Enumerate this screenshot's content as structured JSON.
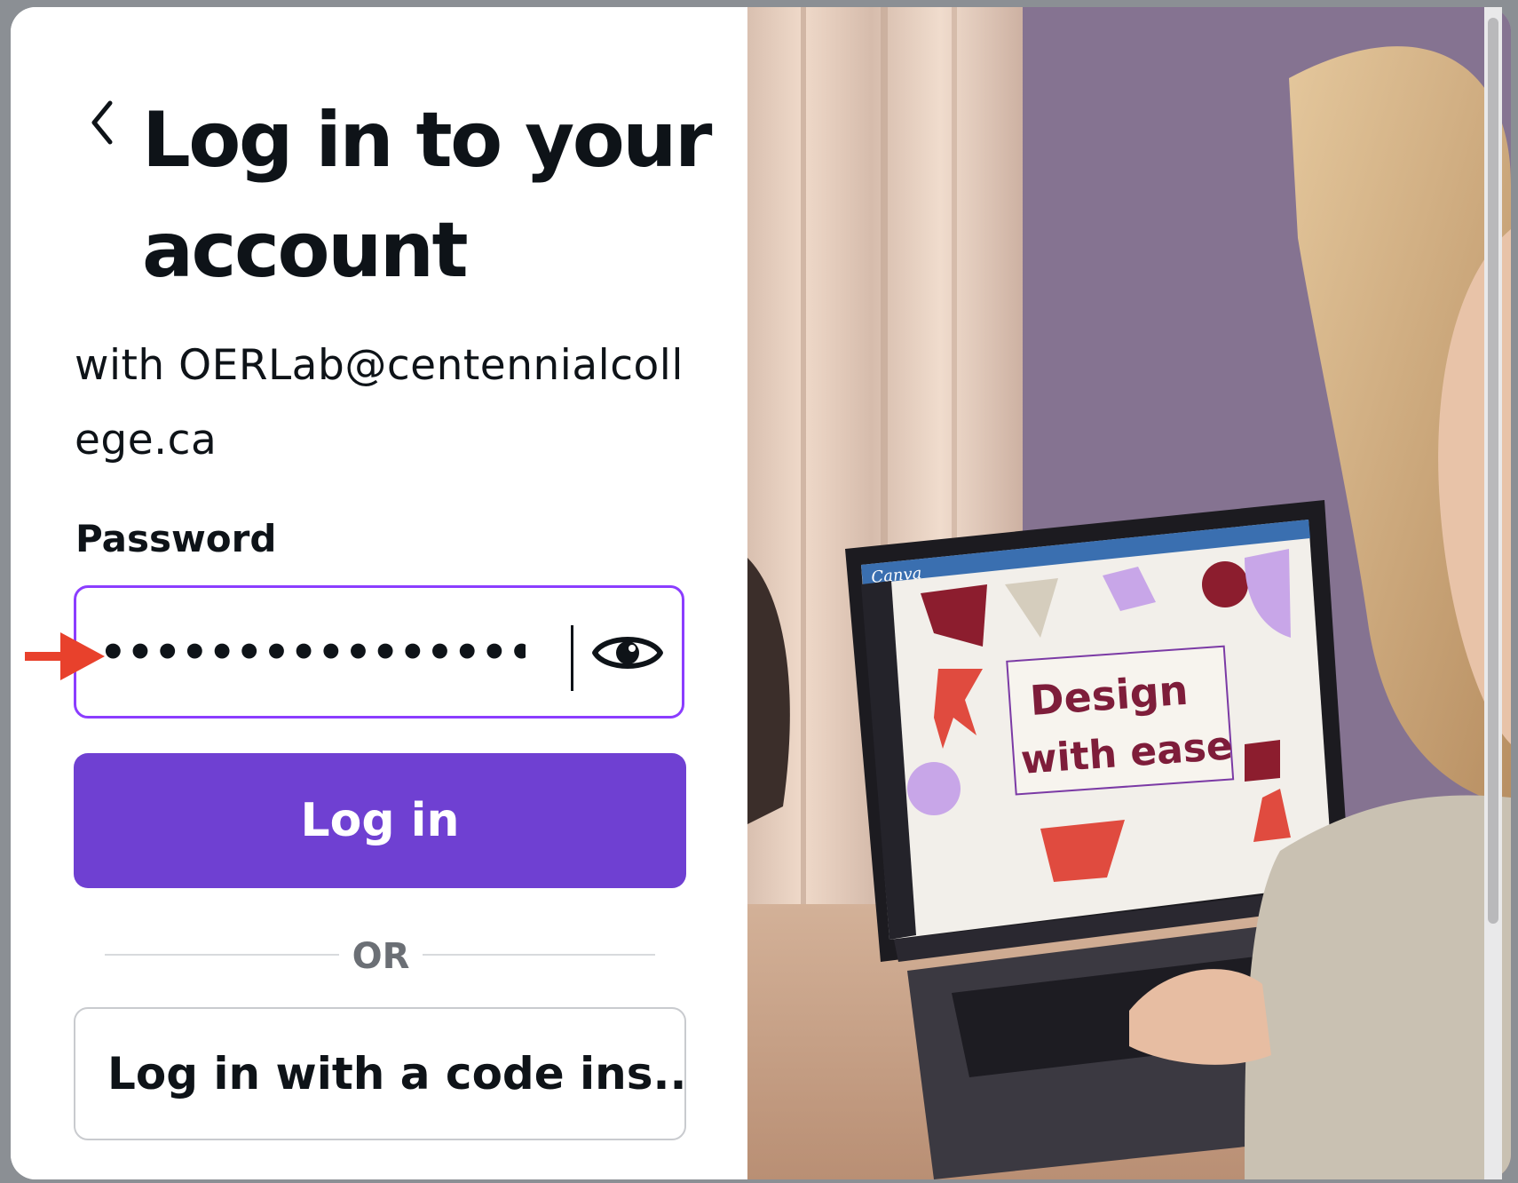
{
  "login": {
    "title": "Log in to your account",
    "subtitle": "with OERLab@centennialcollege.ca",
    "password_label": "Password",
    "password_value": "•••••••••••••••••••••",
    "login_button": "Log in",
    "or_text": "OR",
    "code_button": "Log in with a code ins..."
  },
  "hero": {
    "laptop_app_logo": "Canva",
    "design_text_line1": "Design",
    "design_text_line2": "with ease"
  },
  "colors": {
    "accent": "#8b3dff",
    "primary_button": "#6f40d2",
    "annotation_arrow": "#e8412c"
  },
  "icons": {
    "back": "chevron-left-icon",
    "show_password": "eye-icon",
    "annotation": "red-arrow-icon"
  }
}
